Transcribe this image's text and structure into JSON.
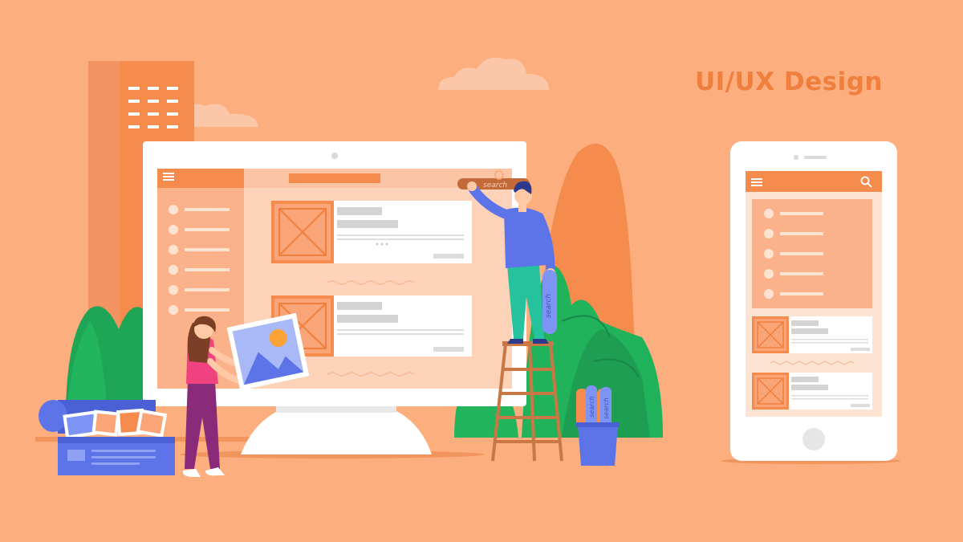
{
  "title": "UI/UX Design",
  "search": {
    "field_label": "search",
    "stick_label": "search",
    "pencil_labels": [
      "search",
      "search",
      "search"
    ]
  },
  "colors": {
    "background": "#FDAE7E",
    "accent": "#F58B4C",
    "title": "#F07F3E",
    "screen_panel": "#FCD2B8",
    "thumbnail": "#F9A577",
    "green": "#21B25C",
    "blue": "#5C74E8",
    "pink": "#F0427E"
  },
  "icons": [
    "hamburger-menu-icon",
    "search-icon",
    "image-placeholder-icon",
    "mountain-sun-photo-icon",
    "home-button-icon",
    "camera-dot-icon"
  ]
}
